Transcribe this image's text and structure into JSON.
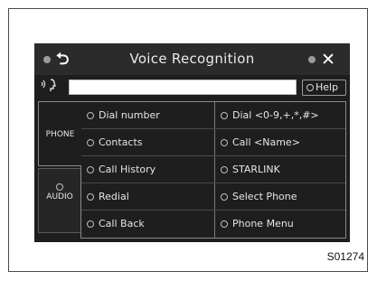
{
  "title": "Voice Recognition",
  "header": {
    "back_icon": "back-arrow",
    "close_icon": "close-x"
  },
  "input": {
    "value": "",
    "placeholder": ""
  },
  "help_label": "Help",
  "tabs": [
    {
      "label": "PHONE",
      "selected": true
    },
    {
      "label": "AUDIO",
      "selected": false
    }
  ],
  "commands": [
    [
      "Dial number",
      "Dial <0-9,+,*,#>"
    ],
    [
      "Contacts",
      "Call <Name>"
    ],
    [
      "Call History",
      "STARLINK"
    ],
    [
      "Redial",
      "Select Phone"
    ],
    [
      "Call Back",
      "Phone Menu"
    ]
  ],
  "figure_code": "S01274",
  "colors": {
    "background": "#1e1e1e",
    "text": "#e6e6e6"
  }
}
